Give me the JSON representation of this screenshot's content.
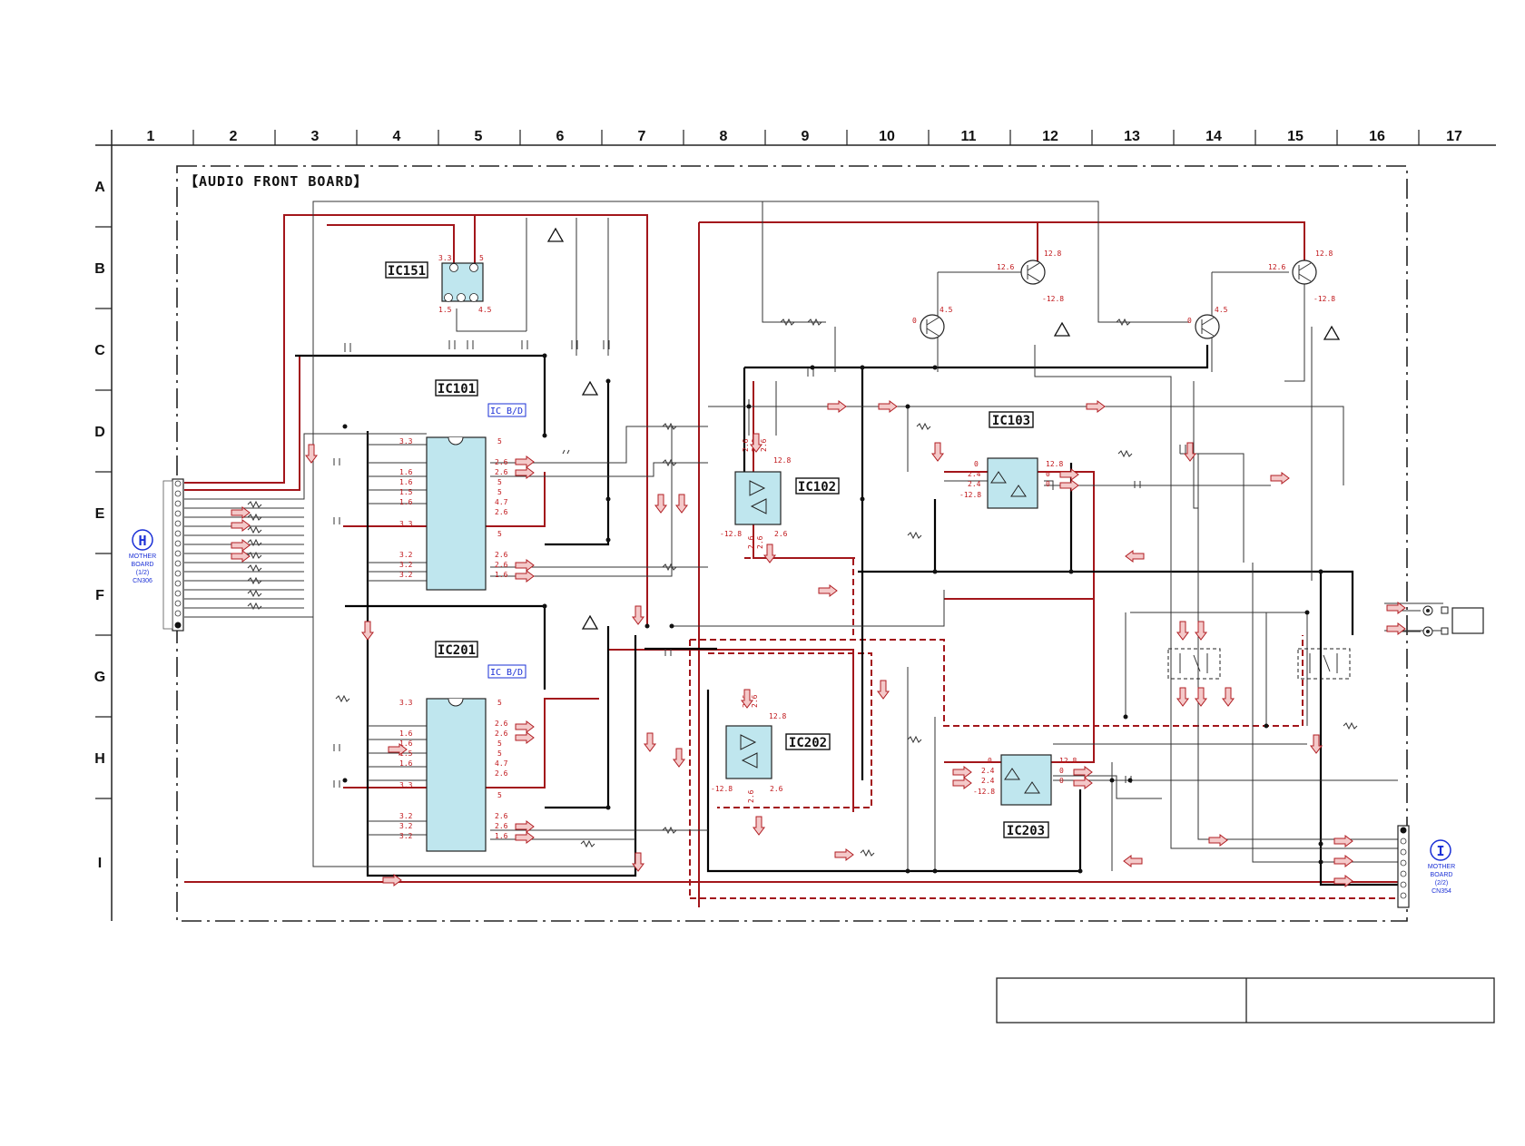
{
  "grid": {
    "columns": [
      "1",
      "2",
      "3",
      "4",
      "5",
      "6",
      "7",
      "8",
      "9",
      "10",
      "11",
      "12",
      "13",
      "14",
      "15",
      "16",
      "17"
    ],
    "rows": [
      "A",
      "B",
      "C",
      "D",
      "E",
      "F",
      "G",
      "H",
      "I"
    ]
  },
  "board_title": "【AUDIO FRONT BOARD】",
  "ics": {
    "ic151": "IC151",
    "ic101": "IC101",
    "ic201": "IC201",
    "ic102": "IC102",
    "ic103": "IC103",
    "ic202": "IC202",
    "ic203": "IC203",
    "ic_bd_1": "IC B/D",
    "ic_bd_2": "IC B/D"
  },
  "connectors": {
    "left": {
      "letter": "H",
      "lines": [
        "MOTHER",
        "BOARD",
        "(1/2)",
        "CN306"
      ]
    },
    "right": {
      "letter": "I",
      "lines": [
        "MOTHER",
        "BOARD",
        "(2/2)",
        "CN354"
      ]
    }
  },
  "voltages": {
    "ic151": [
      "3.3",
      "5",
      "1.5",
      "4.5"
    ],
    "ic101_left": [
      "3.3",
      "1.6",
      "1.6",
      "1.5",
      "1.6",
      "3.3",
      "3.2",
      "3.2",
      "3.2"
    ],
    "ic101_right": [
      "5",
      "2.6",
      "2.6",
      "5",
      "5",
      "4.7",
      "2.6",
      "5",
      "2.6",
      "2.6",
      "1.6"
    ],
    "ic201_left": [
      "3.3",
      "1.6",
      "1.6",
      "1.5",
      "1.6",
      "3.3",
      "3.2",
      "3.2",
      "3.2"
    ],
    "ic201_right": [
      "5",
      "2.6",
      "2.6",
      "5",
      "5",
      "4.7",
      "2.6",
      "5",
      "2.6",
      "2.6",
      "1.6"
    ],
    "ic102": [
      "2.6",
      "2.6",
      "2.6",
      "12.8",
      "-12.8",
      "2.6",
      "2.6",
      "2.6"
    ],
    "ic202": [
      "2.6",
      "2.6",
      "12.8",
      "-12.8",
      "2.6",
      "2.6"
    ],
    "ic103": [
      "0",
      "2.4",
      "2.4",
      "-12.8",
      "12.8",
      "0",
      "0"
    ],
    "ic203": [
      "0",
      "2.4",
      "2.4",
      "-12.8",
      "12.8",
      "0",
      "0"
    ],
    "transistors": [
      "12.8",
      "12.6",
      "-12.8",
      "0",
      "4.5",
      "12.8",
      "12.6",
      "-12.8",
      "0",
      "4.5"
    ]
  },
  "colors": {
    "signal_red": "#a3161b",
    "chip_fill": "#bfe6ee",
    "annotation_blue": "#1a2fd6"
  }
}
